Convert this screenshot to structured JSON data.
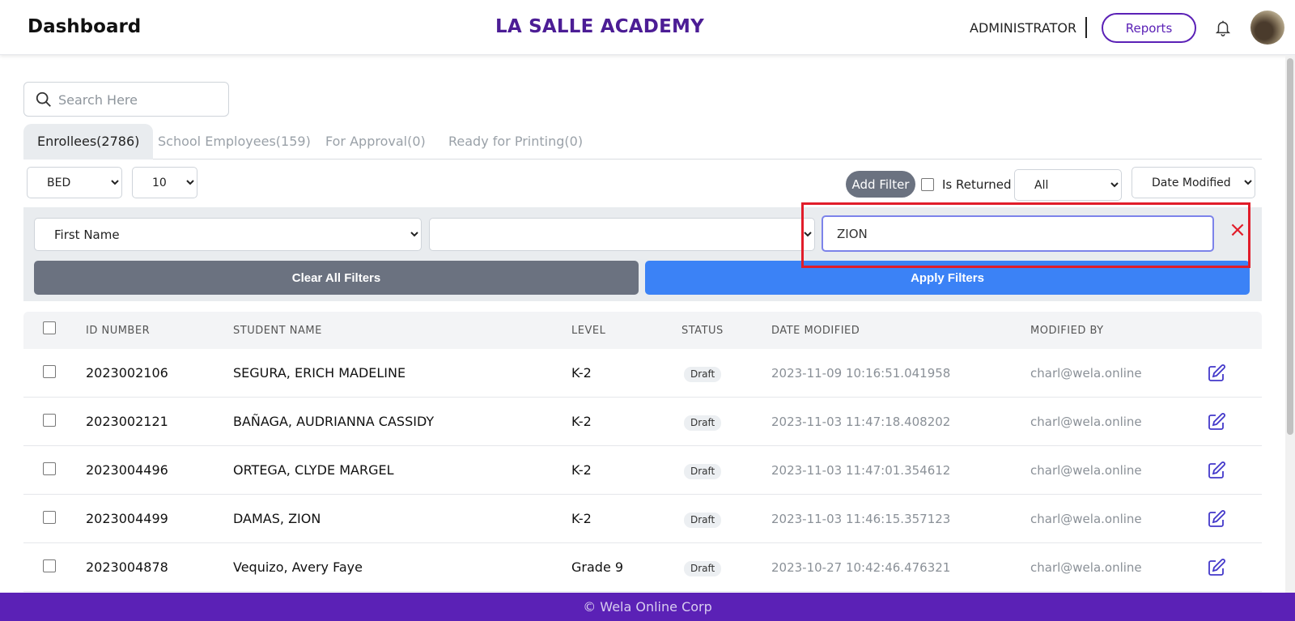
{
  "header": {
    "brand": "Dashboard",
    "school": "LA SALLE ACADEMY",
    "role": "ADMINISTRATOR",
    "reports_label": "Reports"
  },
  "search": {
    "placeholder": "Search Here"
  },
  "tabs": [
    {
      "label": "Enrollees(2786)",
      "active": true
    },
    {
      "label": "School Employees(159)",
      "active": false
    },
    {
      "label": "For Approval(0)",
      "active": false
    },
    {
      "label": "Ready for Printing(0)",
      "active": false
    }
  ],
  "controls": {
    "department": "BED",
    "page_size": "10",
    "add_filter_label": "Add Filter",
    "is_returned_label": "Is Returned",
    "status_select": "All",
    "sort_select": "Date Modified"
  },
  "filter": {
    "field": "First Name",
    "operator": "",
    "value": "ZION",
    "remove_symbol": "×",
    "clear_label": "Clear All Filters",
    "apply_label": "Apply Filters"
  },
  "table": {
    "columns": [
      "ID NUMBER",
      "STUDENT NAME",
      "LEVEL",
      "STATUS",
      "DATE MODIFIED",
      "MODIFIED BY"
    ],
    "rows": [
      {
        "id": "2023002106",
        "name": "SEGURA, ERICH MADELINE",
        "level": "K-2",
        "status": "Draft",
        "date": "2023-11-09 10:16:51.041958",
        "by": "charl@wela.online"
      },
      {
        "id": "2023002121",
        "name": "BAÑAGA, AUDRIANNA CASSIDY",
        "level": "K-2",
        "status": "Draft",
        "date": "2023-11-03 11:47:18.408202",
        "by": "charl@wela.online"
      },
      {
        "id": "2023004496",
        "name": "ORTEGA, CLYDE MARGEL",
        "level": "K-2",
        "status": "Draft",
        "date": "2023-11-03 11:47:01.354612",
        "by": "charl@wela.online"
      },
      {
        "id": "2023004499",
        "name": "DAMAS, ZION",
        "level": "K-2",
        "status": "Draft",
        "date": "2023-11-03 11:46:15.357123",
        "by": "charl@wela.online"
      },
      {
        "id": "2023004878",
        "name": "Vequizo, Avery Faye",
        "level": "Grade 9",
        "status": "Draft",
        "date": "2023-10-27 10:42:46.476321",
        "by": "charl@wela.online"
      }
    ]
  },
  "footer": {
    "text": "© Wela Online Corp"
  },
  "colors": {
    "brand_purple": "#5b21b6",
    "apply_blue": "#3b82f6",
    "highlight_red": "#e11d2a"
  }
}
